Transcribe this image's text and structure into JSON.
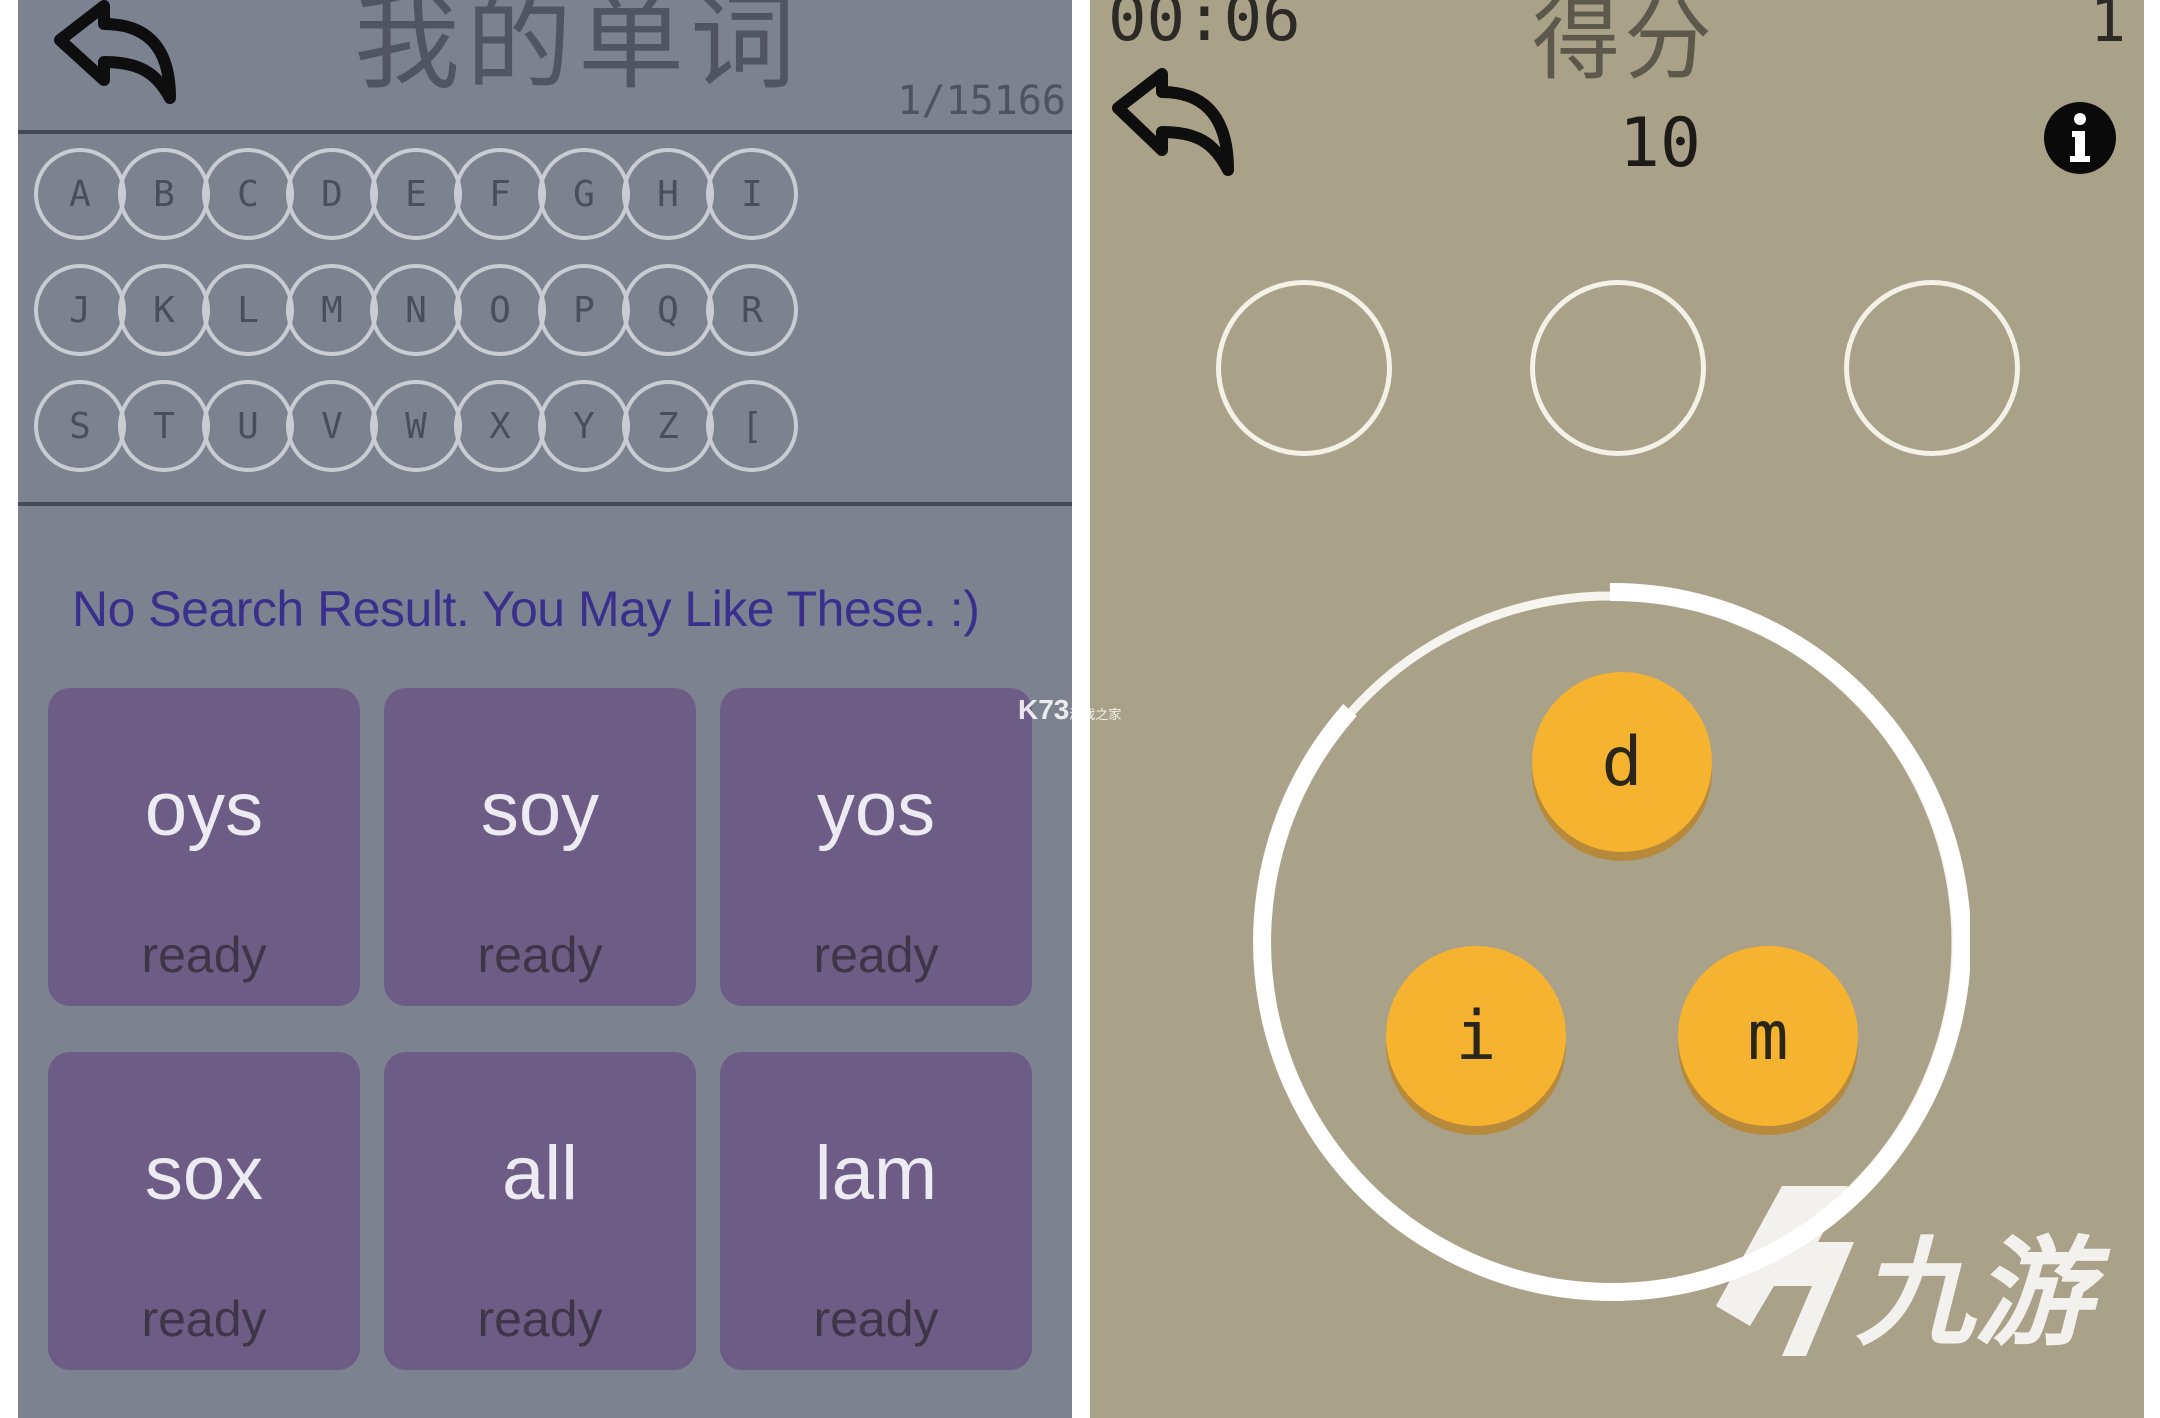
{
  "left": {
    "title": "我的单词",
    "count": "1/15166",
    "letters": [
      "A",
      "B",
      "C",
      "D",
      "E",
      "F",
      "G",
      "H",
      "I",
      "J",
      "K",
      "L",
      "M",
      "N",
      "O",
      "P",
      "Q",
      "R",
      "S",
      "T",
      "U",
      "V",
      "W",
      "X",
      "Y",
      "Z",
      "["
    ],
    "message": "No Search Result. You May Like These. :)",
    "cards": [
      {
        "word": "oys",
        "status": "ready"
      },
      {
        "word": "soy",
        "status": "ready"
      },
      {
        "word": "yos",
        "status": "ready"
      },
      {
        "word": "sox",
        "status": "ready"
      },
      {
        "word": "all",
        "status": "ready"
      },
      {
        "word": "lam",
        "status": "ready"
      }
    ]
  },
  "right": {
    "timer": "00:06",
    "score_label": "得分",
    "level": "1",
    "score": "10",
    "tiles": [
      "d",
      "i",
      "m"
    ]
  },
  "watermark": {
    "k73": "K73",
    "k73_sub": "游戏之家",
    "jiuyou": "九游"
  },
  "colors": {
    "left_bg": "#7d8290",
    "card": "#6d5c85",
    "message": "#3b2f8e",
    "right_bg": "#a9a188",
    "tile": "#f5b330"
  },
  "icons": [
    "back-arrow-icon",
    "info-icon"
  ]
}
